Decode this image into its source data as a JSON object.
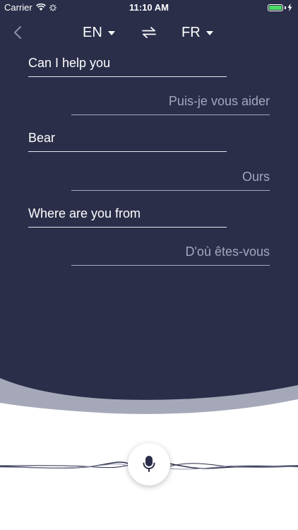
{
  "status_bar": {
    "carrier": "Carrier",
    "time": "11:10 AM",
    "battery_level": 1.0
  },
  "nav": {
    "back_icon": "chevron-left-icon",
    "source_language": "EN",
    "target_language": "FR",
    "swap_icon": "swap-arrows-icon"
  },
  "translations": [
    {
      "source": "Can I help you",
      "target": "Puis-je vous aider"
    },
    {
      "source": "Bear",
      "target": "Ours"
    },
    {
      "source": "Where are you from",
      "target": "D'où êtes-vous"
    }
  ],
  "mic": {
    "icon": "microphone-icon"
  },
  "colors": {
    "background_dark": "#2b2e49",
    "wave_light": "#a5a8b8",
    "text_primary": "#ffffff",
    "text_secondary": "#a4a7bb",
    "battery": "#4cd964"
  }
}
